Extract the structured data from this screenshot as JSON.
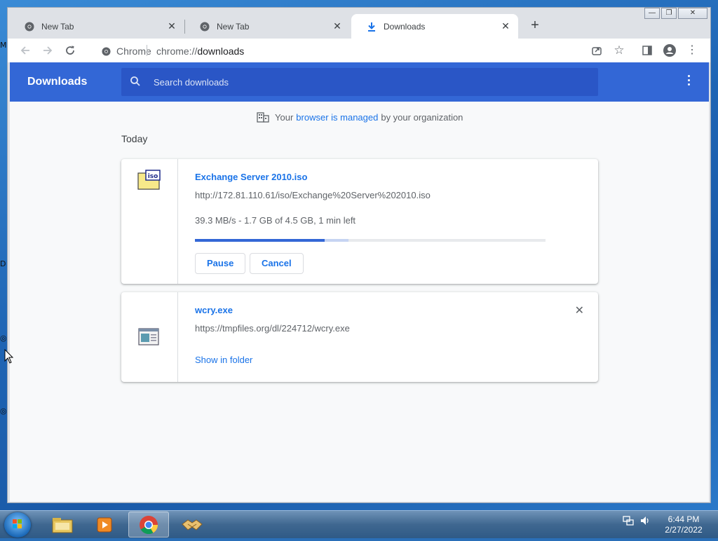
{
  "browser": {
    "tabs": [
      {
        "label": "New Tab",
        "active": false,
        "icon": "chrome-icon"
      },
      {
        "label": "New Tab",
        "active": false,
        "icon": "chrome-icon"
      },
      {
        "label": "Downloads",
        "active": true,
        "icon": "download-icon"
      }
    ],
    "omnibox": {
      "site_label": "Chrome",
      "url_scheme": "chrome://",
      "url_path": "downloads"
    }
  },
  "page": {
    "title": "Downloads",
    "search_placeholder": "Search downloads",
    "managed": {
      "prefix": "Your",
      "link": "browser is managed",
      "suffix": "by your organization"
    },
    "section": "Today",
    "downloads": [
      {
        "name": "Exchange Server 2010.iso",
        "url": "http://172.81.110.61/iso/Exchange%20Server%202010.iso",
        "status": "39.3 MB/s - 1.7 GB of 4.5 GB, 1 min left",
        "progress": 0.37,
        "actions": [
          "Pause",
          "Cancel"
        ],
        "icon": "iso-file-icon"
      },
      {
        "name": "wcry.exe",
        "url": "https://tmpfiles.org/dl/224712/wcry.exe",
        "link": "Show in folder",
        "icon": "exe-file-icon"
      }
    ]
  },
  "taskbar": {
    "time": "6:44 PM",
    "date": "2/27/2022",
    "items": [
      "explorer-icon",
      "media-player-icon",
      "chrome-icon",
      "handshake-icon"
    ]
  },
  "colors": {
    "header": "#3367d6",
    "search": "#2a56c6",
    "link": "#1a73e8"
  }
}
